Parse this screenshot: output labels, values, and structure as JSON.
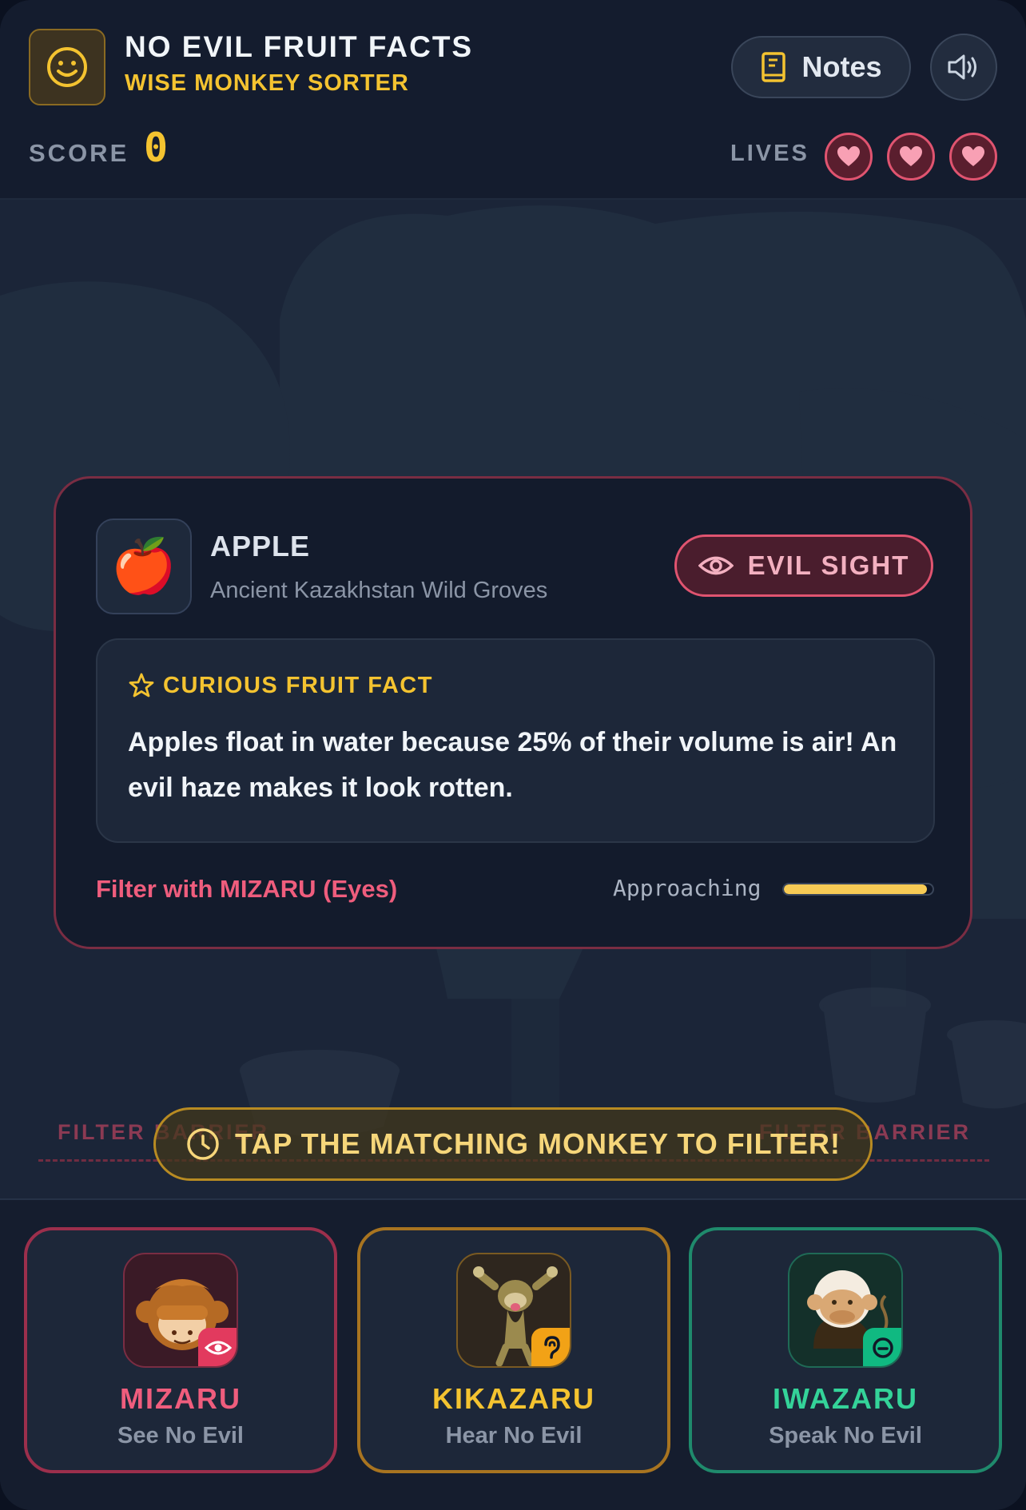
{
  "header": {
    "title": "NO EVIL FRUIT FACTS",
    "subtitle": "WISE MONKEY SORTER",
    "notes_label": "Notes",
    "logo_icon": "smiley-icon",
    "sound_icon": "speaker-icon"
  },
  "stats": {
    "score_label": "SCORE",
    "score": "0",
    "lives_label": "LIVES",
    "lives": 3
  },
  "fact_card": {
    "fruit_icon": "🍎",
    "fruit_name": "APPLE",
    "origin": "Ancient Kazakhstan Wild Groves",
    "category_label": "EVIL SIGHT",
    "fact_heading": "CURIOUS FRUIT FACT",
    "fact_text": "Apples float in water because 25% of their volume is air! An evil haze makes it look rotten.",
    "filter_hint": "Filter with MIZARU (Eyes)",
    "approach_label": "Approaching",
    "approach_progress": 0.96
  },
  "barrier": {
    "left_label": "FILTER BARRIER",
    "right_label": "FILTER BARRIER",
    "banner": "TAP THE MATCHING MONKEY TO FILTER!"
  },
  "monkeys": [
    {
      "name": "MIZARU",
      "desc": "See No Evil",
      "color": "#ef5d7d",
      "badge_icon": "eye-icon"
    },
    {
      "name": "KIKAZARU",
      "desc": "Hear No Evil",
      "color": "#f4c330",
      "badge_icon": "ear-icon"
    },
    {
      "name": "IWAZARU",
      "desc": "Speak No Evil",
      "color": "#34d399",
      "badge_icon": "mouth-icon"
    }
  ],
  "colors": {
    "accent_gold": "#f4c330",
    "evil_red": "#e05470",
    "background": "#1b2538"
  }
}
